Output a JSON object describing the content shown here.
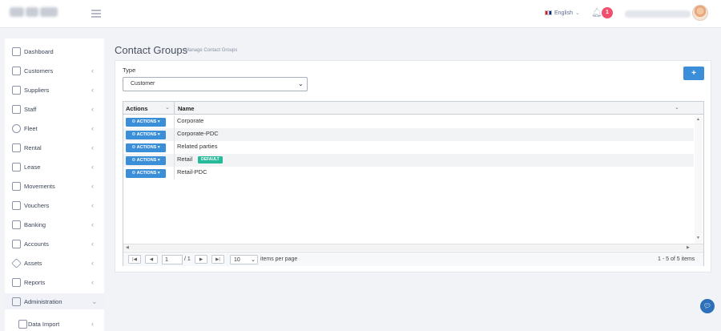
{
  "header": {
    "language": "English",
    "notifications_count": "1"
  },
  "sidebar": {
    "items": [
      {
        "label": "Dashboard",
        "icon": "home-icon"
      },
      {
        "label": "Customers",
        "icon": "users-icon"
      },
      {
        "label": "Suppliers",
        "icon": "layers-icon"
      },
      {
        "label": "Staff",
        "icon": "staff-icon"
      },
      {
        "label": "Fleet",
        "icon": "speedometer-icon"
      },
      {
        "label": "Rental",
        "icon": "book-icon"
      },
      {
        "label": "Lease",
        "icon": "stack-icon"
      },
      {
        "label": "Movements",
        "icon": "signpost-icon"
      },
      {
        "label": "Vouchers",
        "icon": "document-icon"
      },
      {
        "label": "Banking",
        "icon": "folder-icon"
      },
      {
        "label": "Accounts",
        "icon": "ledger-icon"
      },
      {
        "label": "Assets",
        "icon": "diamond-icon"
      },
      {
        "label": "Reports",
        "icon": "bar-chart-icon"
      },
      {
        "label": "Administration",
        "icon": "wrench-icon"
      },
      {
        "label": "Data Import",
        "icon": "tool-icon"
      }
    ]
  },
  "page": {
    "title": "Contact Groups",
    "subtitle": "Manage Contact Groups",
    "add_label": "+"
  },
  "filter": {
    "type_label": "Type",
    "type_value": "Customer"
  },
  "grid": {
    "col_actions": "Actions",
    "col_name": "Name",
    "action_label": "⚙ ACTIONS ▾",
    "rows": [
      {
        "name": "Corporate"
      },
      {
        "name": "Corporate-PDC"
      },
      {
        "name": "Related parties"
      },
      {
        "name": "Retail",
        "badge": "DEFAULT"
      },
      {
        "name": "Retail-PDC"
      }
    ]
  },
  "pager": {
    "page": "1",
    "of": "/ 1",
    "per_page": "10",
    "per_page_label": "items per page",
    "count": "1 - 5 of 5 items"
  }
}
